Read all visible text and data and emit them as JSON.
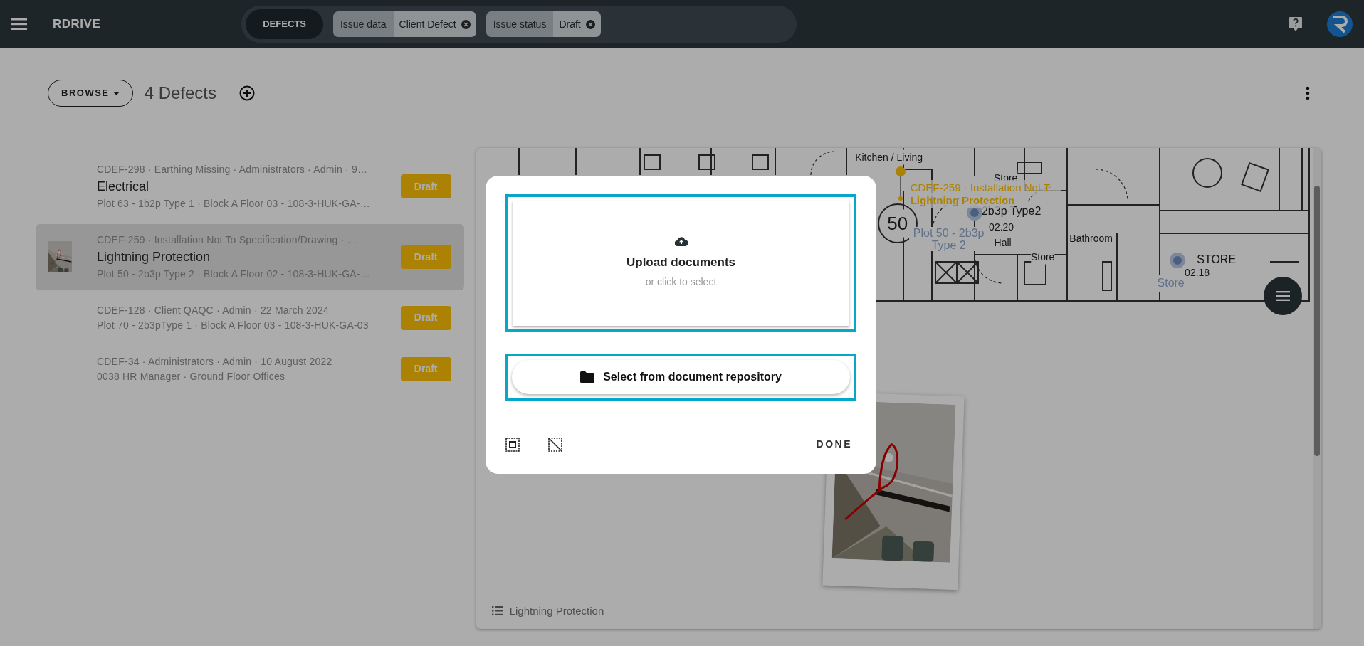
{
  "top_bar": {
    "logo": "RDRIVE",
    "search": {
      "scope": "DEFECTS",
      "filters": [
        {
          "field": "Issue data",
          "value": "Client Defect"
        },
        {
          "field": "Issue status",
          "value": "Draft"
        }
      ]
    }
  },
  "toolbar": {
    "browse": "BROWSE",
    "count": "4 Defects"
  },
  "defects": [
    {
      "meta": "CDEF-298 · Earthing Missing · Administrators · Admin · 9…",
      "title": "Electrical",
      "location": "Plot 63 - 1b2p Type 1 · Block A Floor 03 - 108-3-HUK-GA-…",
      "status": "Draft",
      "selected": false
    },
    {
      "meta": "CDEF-259 · Installation Not To Specification/Drawing · …",
      "title": "Lightning Protection",
      "location": "Plot 50 - 2b3p Type 2 · Block A Floor 02 - 108-3-HUK-GA-…",
      "status": "Draft",
      "selected": true,
      "thumbnail": true
    },
    {
      "meta": "CDEF-128 · Client QAQC · Admin · 22 March 2024",
      "location": "Plot 70 - 2b3pType 1 · Block A Floor 03 - 108-3-HUK-GA-03",
      "status": "Draft",
      "selected": false
    },
    {
      "meta": "CDEF-34 · Administrators · Admin · 10 August 2022",
      "location": "0038 HR Manager · Ground Floor Offices",
      "status": "Draft",
      "selected": false
    }
  ],
  "floor_plan": {
    "room_labels": [
      "Kitchen / Living",
      "Store",
      "50",
      "2b3p Type2",
      "02.20",
      "Hall",
      "Bathroom",
      "Store",
      "STORE",
      "02.18"
    ],
    "locations": [
      {
        "label": "Plot 50 - 2b3p Type 2"
      },
      {
        "label": "Store"
      }
    ],
    "pin": {
      "code": "CDEF-259 · Installation Not T…",
      "title": "Lightning Protection"
    },
    "caption": "Lightning Protection"
  },
  "dialog": {
    "upload_title": "Upload documents",
    "upload_hint": "or click to select",
    "repository_button": "Select from document repository",
    "done": "DONE"
  }
}
